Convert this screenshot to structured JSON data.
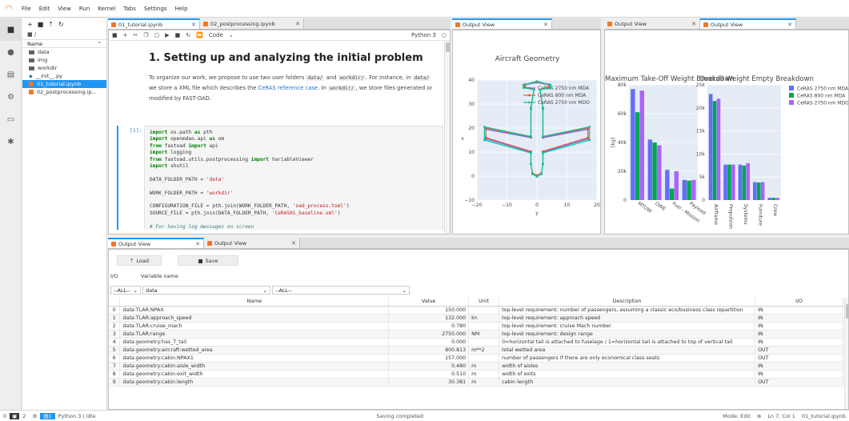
{
  "menubar": {
    "items": [
      "File",
      "Edit",
      "View",
      "Run",
      "Kernel",
      "Tabs",
      "Settings",
      "Help"
    ]
  },
  "filebrowser": {
    "breadcrumb": "■ /",
    "header_name": "Name",
    "items": [
      {
        "label": "data",
        "type": "folder"
      },
      {
        "label": "img",
        "type": "folder"
      },
      {
        "label": "workdir",
        "type": "folder"
      },
      {
        "label": "__init__.py",
        "type": "py"
      },
      {
        "label": "01_tutorial.ipynb",
        "type": "nb",
        "selected": true
      },
      {
        "label": "02_postprocessing.ip...",
        "type": "nb"
      }
    ]
  },
  "notebook": {
    "tabs": [
      "01_tutorial.ipynb",
      "02_postprocessing.ipynb"
    ],
    "cell_type": "Code",
    "kernel": "Python 3",
    "heading": "1. Setting up and analyzing the initial problem",
    "md_1": "To organize our work, we propose to use two user folders",
    "md_code_1": "data/",
    "md_2": "and",
    "md_code_2": "workdir/",
    "md_3": ". For instance, in",
    "md_code_3": "data/",
    "md_4": "we store a XML file which describes the",
    "md_link": "CeRAS reference case",
    "md_5": ". In",
    "md_code_4": "workdir/",
    "md_6": ", we store files generated or modified by FAST-OAD.",
    "prompt": "[1]:",
    "code_lines": [
      [
        "kw:import",
        " os.path ",
        "kw:as",
        " pth"
      ],
      [
        "kw:import",
        " openmdao.api ",
        "kw:as",
        " om"
      ],
      [
        "kw:from",
        " fastoad ",
        "kw:import",
        " api"
      ],
      [
        "kw:import",
        " logging"
      ],
      [
        "kw:from",
        " fastoad.utils.postprocessing ",
        "kw:import",
        " VariableViewer"
      ],
      [
        "kw:import",
        " shutil"
      ],
      [
        ""
      ],
      [
        "DATA_FOLDER_PATH = ",
        "str:'data'"
      ],
      [
        ""
      ],
      [
        "WORK_FOLDER_PATH = ",
        "str:'workdir'"
      ],
      [
        ""
      ],
      [
        "CONFIGURATION_FILE = pth.join(WORK_FOLDER_PATH, ",
        "str:'oad_process.toml'",
        ")"
      ],
      [
        "SOURCE_FILE = pth.join(DATA_FOLDER_PATH, ",
        "str:'CeRAS01_baseline.xml'",
        ")"
      ],
      [
        ""
      ],
      [
        "cm:# For having log messages on screen"
      ],
      [
        "logging.basicConfig(level=logging.INFO, format=",
        "str:'%(levelname)-8s: %(message)s'",
        ")"
      ]
    ]
  },
  "geometry_view": {
    "tab": "Output View",
    "chart_data": {
      "type": "line",
      "title": "Aircraft Geometry",
      "xlabel": "y",
      "ylabel": "x",
      "xlim": [
        -20,
        20
      ],
      "ylim": [
        -10,
        40
      ],
      "xticks": [
        -20,
        -10,
        0,
        10,
        20
      ],
      "yticks": [
        -10,
        0,
        10,
        20,
        30,
        40
      ],
      "legend_position": "top-right",
      "series": [
        {
          "name": "CeRAS 2750 nm MDA",
          "color": "#636efa",
          "points": [
            [
              0,
              0
            ],
            [
              -1.5,
              1
            ],
            [
              -2,
              5
            ],
            [
              -2,
              10
            ],
            [
              -17,
              15.5
            ],
            [
              -17,
              19.5
            ],
            [
              -2,
              16
            ],
            [
              -2,
              28
            ],
            [
              -1,
              36
            ],
            [
              -4,
              37
            ],
            [
              -4,
              38
            ],
            [
              0,
              39
            ],
            [
              4,
              38
            ],
            [
              4,
              37
            ],
            [
              1,
              36
            ],
            [
              2,
              28
            ],
            [
              2,
              16
            ],
            [
              17,
              19.5
            ],
            [
              17,
              15.5
            ],
            [
              2,
              10
            ],
            [
              2,
              5
            ],
            [
              1.5,
              1
            ],
            [
              0,
              0
            ]
          ]
        },
        {
          "name": "CeRAS 800 nm MDA",
          "color": "#ef553b",
          "points": [
            [
              0,
              0.3
            ],
            [
              -1.5,
              1.2
            ],
            [
              -2,
              5
            ],
            [
              -2,
              10.3
            ],
            [
              -17,
              16
            ],
            [
              -17,
              20
            ],
            [
              -2,
              16.3
            ],
            [
              -2,
              28.2
            ],
            [
              -1,
              36
            ],
            [
              -4,
              37.2
            ],
            [
              -4,
              38.2
            ],
            [
              0,
              39.2
            ],
            [
              4,
              38.2
            ],
            [
              4,
              37.2
            ],
            [
              1,
              36
            ],
            [
              2,
              28.2
            ],
            [
              2,
              16.3
            ],
            [
              17,
              20
            ],
            [
              17,
              16
            ],
            [
              2,
              10.3
            ],
            [
              2,
              5
            ],
            [
              1.5,
              1.2
            ],
            [
              0,
              0.3
            ]
          ]
        },
        {
          "name": "CeRAS 2750 nm MDO",
          "color": "#00cc96",
          "points": [
            [
              0,
              -0.2
            ],
            [
              -1.5,
              0.8
            ],
            [
              -2,
              5
            ],
            [
              -2,
              9.6
            ],
            [
              -17.5,
              15
            ],
            [
              -17.5,
              20.5
            ],
            [
              -2,
              16.5
            ],
            [
              -2,
              28.5
            ],
            [
              -1,
              36
            ],
            [
              -4.5,
              36.8
            ],
            [
              -4.5,
              38
            ],
            [
              0,
              39.5
            ],
            [
              4.5,
              38
            ],
            [
              4.5,
              36.8
            ],
            [
              1,
              36
            ],
            [
              2,
              28.5
            ],
            [
              2,
              16.5
            ],
            [
              17.5,
              20.5
            ],
            [
              17.5,
              15
            ],
            [
              2,
              9.6
            ],
            [
              2,
              5
            ],
            [
              1.5,
              0.8
            ],
            [
              0,
              -0.2
            ]
          ]
        }
      ]
    }
  },
  "mass_view": {
    "tabs": [
      "Output View",
      "Output View"
    ],
    "chart_data": [
      {
        "type": "bar",
        "title": "Maximum Take-Off Weight Breakdown",
        "ylabel": "[kg]",
        "categories": [
          "MTOW",
          "OWE",
          "Fuel - Mission",
          "Payload"
        ],
        "ylim": [
          0,
          80000
        ],
        "yticks": [
          0,
          20000,
          40000,
          60000,
          80000
        ],
        "ytick_labels": [
          "0",
          "20k",
          "40k",
          "60k",
          "80k"
        ],
        "series": [
          {
            "name": "CeRAS 2750 nm MDA",
            "color": "#636efa",
            "values": [
              77000,
              42000,
              21000,
              14000
            ]
          },
          {
            "name": "CeRAS 800 nm MDA",
            "color": "#00a651",
            "values": [
              61000,
              40000,
              8000,
              13500
            ]
          },
          {
            "name": "CeRAS 2750 nm MDO",
            "color": "#ab63fa",
            "values": [
              76000,
              38000,
              20000,
              14000
            ]
          }
        ]
      },
      {
        "type": "bar",
        "title": "Overall Weight Empty Breakdown",
        "categories": [
          "Airframe",
          "Propulsion",
          "Systems",
          "Furniture",
          "Crew"
        ],
        "ylim": [
          0,
          25000
        ],
        "yticks": [
          0,
          5000,
          10000,
          15000,
          20000,
          25000
        ],
        "ytick_labels": [
          "0",
          "5k",
          "10k",
          "15k",
          "20k",
          "25k"
        ],
        "series": [
          {
            "name": "CeRAS 2750 nm MDA",
            "color": "#636efa",
            "values": [
              23000,
              7700,
              7700,
              3900,
              500
            ]
          },
          {
            "name": "CeRAS 800 nm MDA",
            "color": "#00a651",
            "values": [
              21500,
              7700,
              7500,
              3800,
              500
            ]
          },
          {
            "name": "CeRAS 2750 nm MDO",
            "color": "#ab63fa",
            "values": [
              22000,
              7700,
              8000,
              3900,
              500
            ]
          }
        ]
      }
    ]
  },
  "table_view": {
    "tabs": [
      "Output View",
      "Output View"
    ],
    "load_label": "Load",
    "save_label": "Save",
    "io_label": "I/O",
    "varname_label": "Variable name",
    "filter_io": "--ALL--",
    "filter_1": "data",
    "filter_2": "--ALL--",
    "columns": [
      "",
      "Name",
      "Value",
      "Unit",
      "Description",
      "I/O"
    ],
    "rows": [
      [
        "0",
        "data:TLAR:NPAX",
        "150.000",
        "",
        "top-level requirement: number of passengers, assuming a classic eco/business class repartition",
        "IN"
      ],
      [
        "1",
        "data:TLAR:approach_speed",
        "132.000",
        "kn",
        "top-level requirement: approach speed",
        "IN"
      ],
      [
        "2",
        "data:TLAR:cruise_mach",
        "0.780",
        "",
        "top-level requirement: cruise Mach number",
        "IN"
      ],
      [
        "3",
        "data:TLAR:range",
        "2750.000",
        "NM",
        "top-level requirement: design range",
        "IN"
      ],
      [
        "4",
        "data:geometry:has_T_tail",
        "0.000",
        "",
        "0=horizontal tail is attached to fuselage / 1=horizontal tail is attached to top of vertical tail",
        "IN"
      ],
      [
        "5",
        "data:geometry:aircraft:wetted_area",
        "800.813",
        "m**2",
        "total wetted area",
        "OUT"
      ],
      [
        "6",
        "data:geometry:cabin:NPAX1",
        "157.000",
        "",
        "number of passengers if there are only economical class seats",
        "OUT"
      ],
      [
        "7",
        "data:geometry:cabin:aisle_width",
        "0.480",
        "m",
        "width of aisles",
        "IN"
      ],
      [
        "8",
        "data:geometry:cabin:exit_width",
        "0.510",
        "m",
        "width of exits",
        "IN"
      ],
      [
        "9",
        "data:geometry:cabin:length",
        "30.381",
        "m",
        "cabin length",
        "OUT"
      ]
    ]
  },
  "statusbar": {
    "left_nums": "0",
    "terminals": "2",
    "kernel": "Python 3 | Idle",
    "center": "Saving completed",
    "mode": "Mode: Edit",
    "position": "Ln 7, Col 1",
    "file": "01_tutorial.ipynb"
  }
}
